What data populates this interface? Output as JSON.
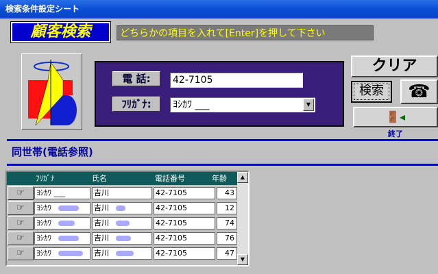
{
  "window": {
    "title": "検索条件設定シート"
  },
  "brand": {
    "title": "顧客検索"
  },
  "hint": {
    "text": "どちらかの項目を入れて[Enter]を押して下さい"
  },
  "search": {
    "phone_label": "電 話:",
    "phone_value": "42-7105",
    "furigana_label": "ﾌﾘｶﾞﾅ:",
    "furigana_value": "ﾖｼｶﾜ ___"
  },
  "buttons": {
    "clear": "クリア",
    "search": "検索",
    "exit_label": "終了"
  },
  "section": {
    "title": "同世帯(電話参照)"
  },
  "table": {
    "headers": [
      "ﾌﾘｶﾞﾅ",
      "氏名",
      "電話番号",
      "年齢"
    ],
    "rows": [
      {
        "furigana": "ﾖｼｶﾜ ___",
        "name": "吉川",
        "phone": "42-7105",
        "age": "43"
      },
      {
        "furigana": "ﾖｼｶﾜ",
        "name": "吉川",
        "phone": "42-7105",
        "age": "12"
      },
      {
        "furigana": "ﾖｼｶﾜ",
        "name": "吉川",
        "phone": "42-7105",
        "age": "74"
      },
      {
        "furigana": "ﾖｼｶﾜ",
        "name": "吉川",
        "phone": "42-7105",
        "age": "76"
      },
      {
        "furigana": "ﾖｼｶﾜ",
        "name": "吉川",
        "phone": "42-7105",
        "age": "47"
      }
    ]
  }
}
